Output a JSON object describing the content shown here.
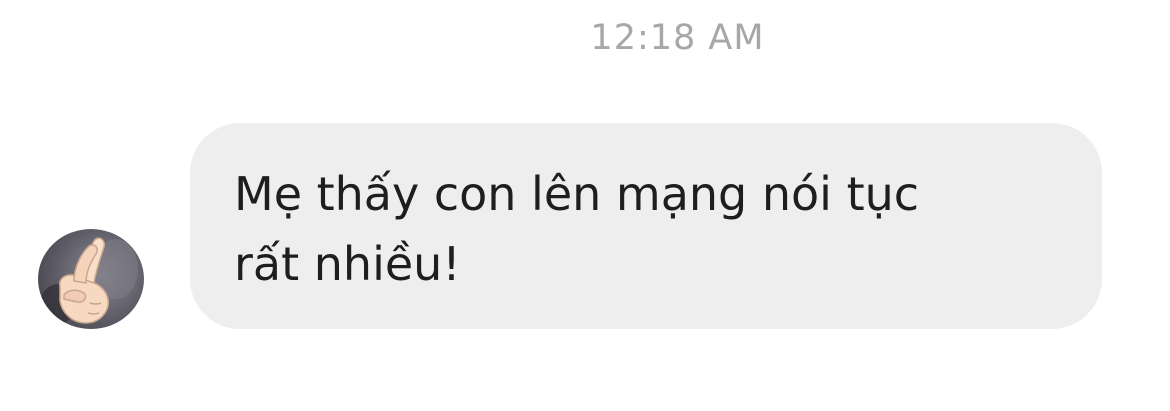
{
  "conversation": {
    "timestamp": "12:18 AM",
    "messages": [
      {
        "direction": "incoming",
        "avatar": {
          "icon": "crossed-fingers-emoji-icon"
        },
        "text": "Mẹ thấy con lên mạng nói tục\nrất nhiều!"
      }
    ]
  },
  "colors": {
    "background": "#ffffff",
    "timestamp_text": "#a7a7a7",
    "bubble": "#efeeef",
    "message_text": "#1e1e1e"
  }
}
